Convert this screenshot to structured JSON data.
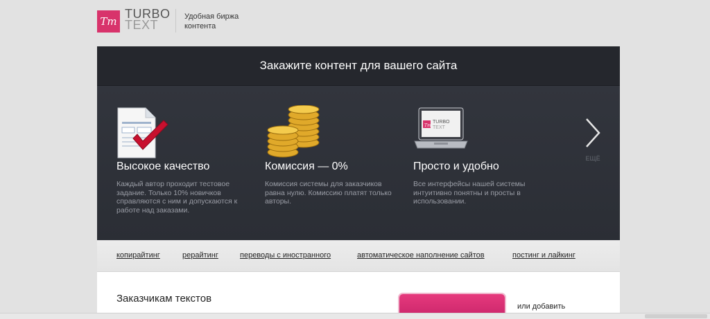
{
  "brand": {
    "mark": "Tт",
    "word1": "TURBO",
    "word2": "TEXT",
    "tagline": "Удобная биржа контента",
    "color": "#d8336b"
  },
  "hero": {
    "title": "Закажите контент для вашего сайта",
    "next_label": "ЕЩЁ",
    "features": [
      {
        "icon": "document-check-icon",
        "title": "Высокое качество",
        "text": "Каждый автор проходит тестовое задание. Только 10% новичков справляются с ним и допускаются к работе над заказами."
      },
      {
        "icon": "coins-icon",
        "title": "Комиссия — 0%",
        "text": "Комиссия системы для заказчиков равна нулю. Комиссию платят только авторы."
      },
      {
        "icon": "laptop-icon",
        "title": "Просто и удобно",
        "text": "Все интерфейсы нашей системы интуитивно понятны и просты в использовании.",
        "screen_word1": "TURBO",
        "screen_word2": "TEXT"
      }
    ]
  },
  "nav": {
    "links": [
      "копирайтинг",
      "рерайтинг",
      "переводы с иностранного",
      "автоматическое наполнение сайтов",
      "постинг и лайкинг"
    ]
  },
  "lower": {
    "title": "Заказчикам текстов",
    "side_link": "или добавить"
  }
}
